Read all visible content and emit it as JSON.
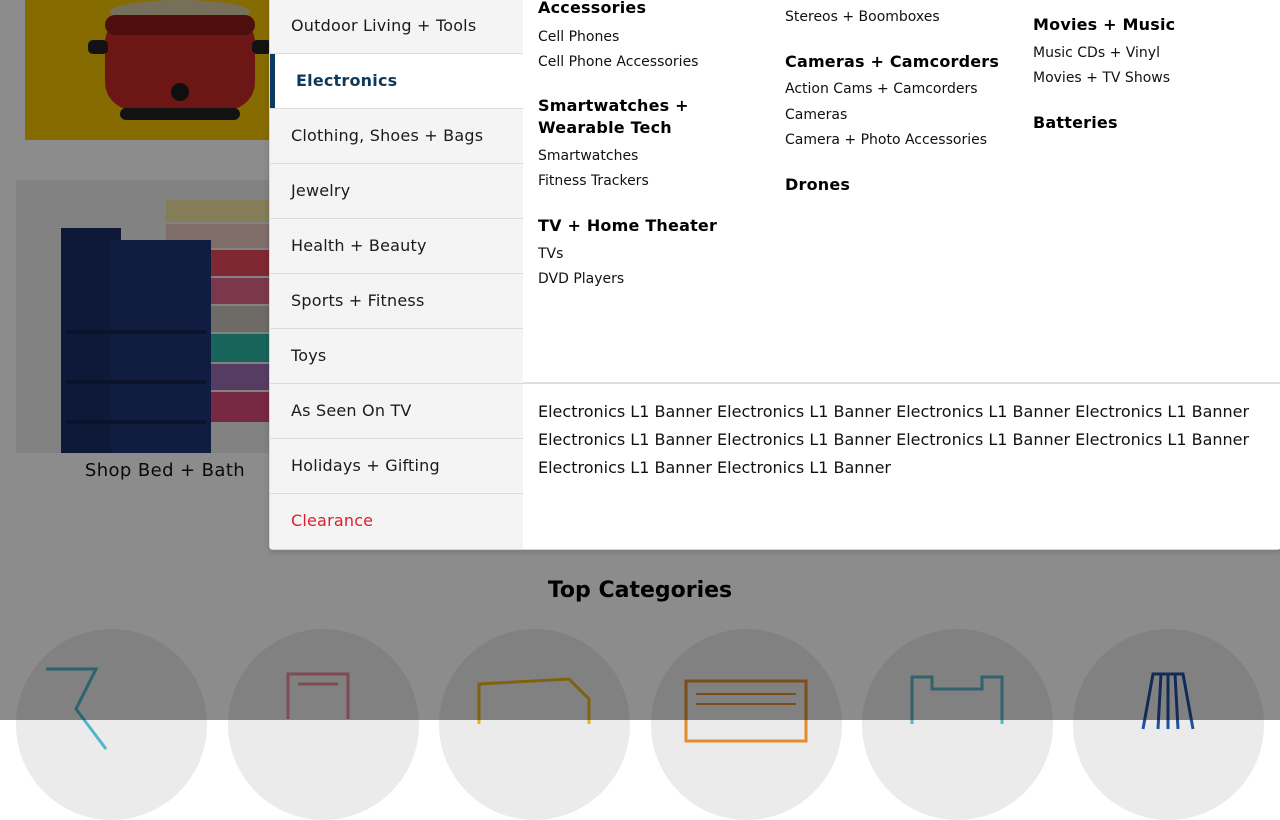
{
  "background": {
    "shop_caption": "Shop Bed + Bath",
    "top_categories_title": "Top Categories"
  },
  "menu": {
    "categories": [
      "Outdoor Living + Tools",
      "Electronics",
      "Clothing, Shoes + Bags",
      "Jewelry",
      "Health + Beauty",
      "Sports + Fitness",
      "Toys",
      "As Seen On TV",
      "Holidays + Gifting",
      "Clearance"
    ],
    "active_category": "Electronics",
    "col1": {
      "accessories_heading": "Accessories",
      "cell_phones": "Cell Phones",
      "cell_phone_accessories": "Cell Phone Accessories",
      "smartwatches_heading": "Smartwatches + Wearable Tech",
      "smartwatches": "Smartwatches",
      "fitness_trackers": "Fitness Trackers",
      "tv_heading": "TV + Home Theater",
      "tvs": "TVs",
      "dvd_players": "DVD Players"
    },
    "col2": {
      "stereos": "Stereos + Boomboxes",
      "cameras_heading": "Cameras + Camcorders",
      "action_cams": "Action Cams + Camcorders",
      "cameras": "Cameras",
      "camera_accessories": "Camera + Photo Accessories",
      "drones_heading": "Drones"
    },
    "col3": {
      "movies_heading": "Movies + Music",
      "music_cds": "Music CDs + Vinyl",
      "movies_tv": "Movies + TV Shows",
      "batteries_heading": "Batteries"
    },
    "banner_text": "Electronics L1 Banner Electronics L1 Banner Electronics L1 Banner Electronics L1 Banner Electronics L1 Banner Electronics L1 Banner Electronics L1 Banner Electronics L1 Banner Electronics L1 Banner Electronics L1 Banner"
  },
  "colors": {
    "active_accent": "#0c3a5e",
    "clearance_red": "#d9202c",
    "menu_bg": "#f4f4f4"
  }
}
